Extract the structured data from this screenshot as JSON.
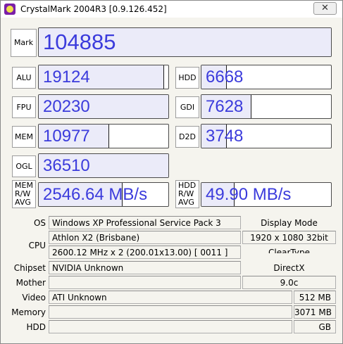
{
  "window": {
    "title": "CrystalMark 2004R3 [0.9.126.452]",
    "close_glyph": "✕"
  },
  "scores": {
    "mark": {
      "label": "Mark",
      "value": "104885",
      "fill": 1.0
    },
    "alu": {
      "label": "ALU",
      "value": "19124",
      "fill": 0.96
    },
    "hdd": {
      "label": "HDD",
      "value": "6668",
      "fill": 0.19
    },
    "fpu": {
      "label": "FPU",
      "value": "20230",
      "fill": 1.0
    },
    "gdi": {
      "label": "GDI",
      "value": "7628",
      "fill": 0.38
    },
    "mem": {
      "label": "MEM",
      "value": "10977",
      "fill": 0.54
    },
    "d2d": {
      "label": "D2D",
      "value": "3748",
      "fill": 0.19
    },
    "ogl": {
      "label": "OGL",
      "value": "36510",
      "fill": 1.0
    },
    "mem_rw": {
      "label_1": "MEM",
      "label_2": "R/W",
      "label_3": "AVG",
      "value": "2546.64 MB/s",
      "fill": 0.64
    },
    "hdd_rw": {
      "label_1": "HDD",
      "label_2": "R/W",
      "label_3": "AVG",
      "value": "49.90 MB/s",
      "fill": 0.25
    }
  },
  "info": {
    "os_label": "OS",
    "os_value": "Windows XP Professional Service Pack 3",
    "cpu_label": "CPU",
    "cpu_name": "Athlon X2 (Brisbane)",
    "cpu_clock": "2600.12 MHz x 2 (200.01x13.00) [ 0011 ]",
    "chipset_label": "Chipset",
    "chipset_value": "NVIDIA Unknown",
    "mother_label": "Mother",
    "mother_value": "",
    "video_label": "Video",
    "video_value": "ATI Unknown",
    "video_mem": "512 MB",
    "memory_label": "Memory",
    "memory_value": "",
    "memory_size": "3071 MB",
    "hdd_label": "HDD",
    "hdd_value": "",
    "hdd_size": "GB",
    "display_mode_label": "Display Mode",
    "display_mode_value": "1920 x 1080 32bit",
    "cleartype_label": "ClearType",
    "cleartype_value": "",
    "directx_label": "DirectX",
    "directx_value": "9.0c"
  }
}
